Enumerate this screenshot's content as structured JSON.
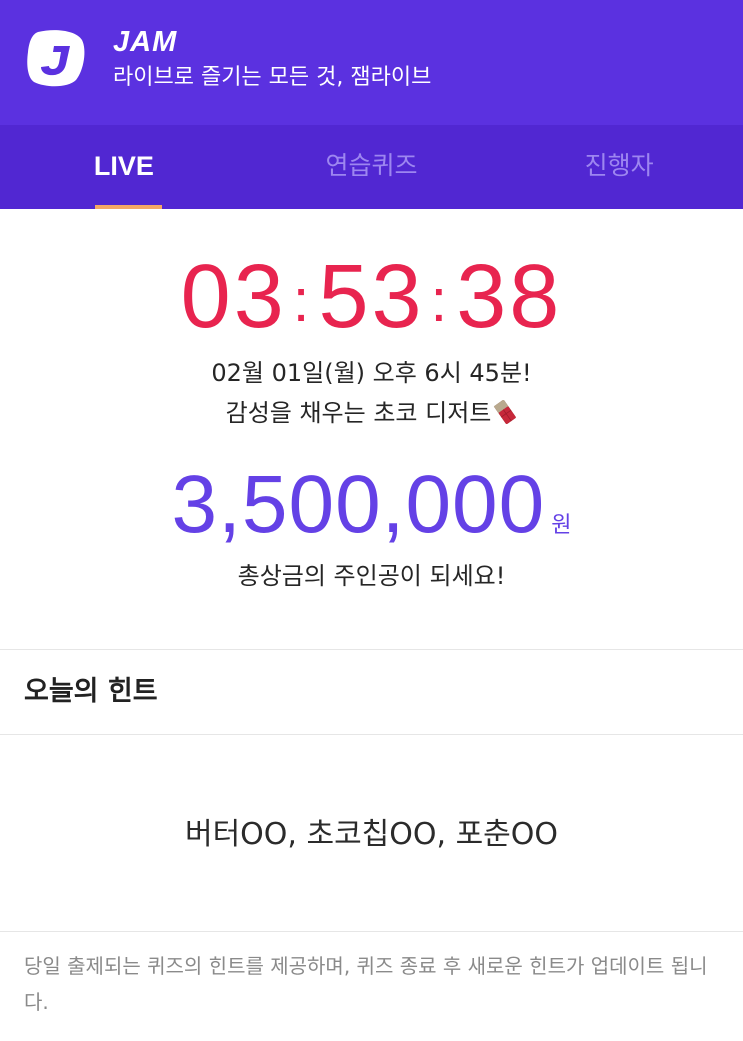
{
  "header": {
    "brand": "JAM",
    "tagline": "라이브로 즐기는 모든 것, 잼라이브",
    "logo_icon": "jam-logo-icon",
    "background": "#5b31e0"
  },
  "tabs": [
    {
      "label": "LIVE",
      "active": true
    },
    {
      "label": "연습퀴즈",
      "active": false
    },
    {
      "label": "진행자",
      "active": false
    }
  ],
  "countdown": {
    "hours": "03",
    "minutes": "53",
    "seconds": "38",
    "separator": ":",
    "color": "#e8244f"
  },
  "schedule": {
    "line1": "02월 01일(월) 오후 6시 45분!",
    "line2": "감성을 채우는 초코 디저트",
    "emoji_icon": "chocolate-bar-icon"
  },
  "prize": {
    "amount": "3,500,000",
    "unit": "원",
    "caption": "총상금의 주인공이 되세요!",
    "color": "#6441e6"
  },
  "hint": {
    "title": "오늘의 힌트",
    "text": "버터OO, 초코칩OO, 포춘OO",
    "note": "당일 출제되는 퀴즈의 힌트를 제공하며, 퀴즈 종료 후 새로운 힌트가 업데이트 됩니다."
  }
}
